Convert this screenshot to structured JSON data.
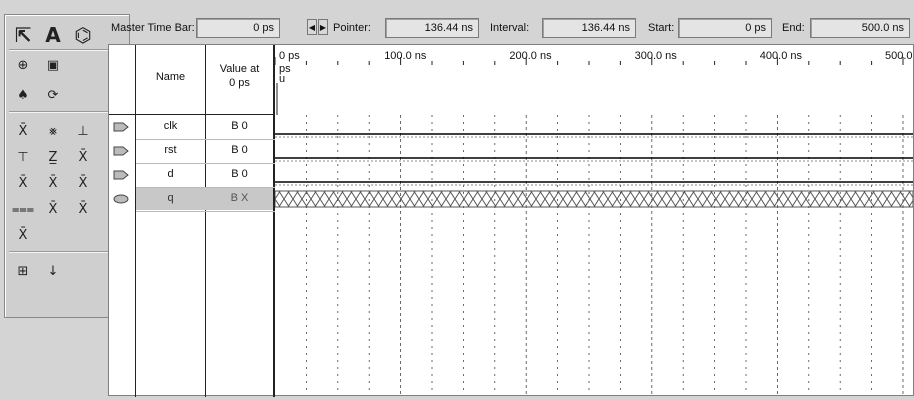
{
  "palette": {
    "tools": [
      {
        "name": "pointer-tool-icon",
        "glyph": "⇱"
      },
      {
        "name": "text-tool-icon",
        "glyph": "A"
      },
      {
        "name": "waveform-editing-tool-icon",
        "glyph": "⌬"
      },
      {
        "name": "zoom-tool-icon",
        "glyph": "⊕"
      },
      {
        "name": "full-screen-icon",
        "glyph": "▣"
      },
      {
        "name": "find-icon",
        "glyph": "♠"
      },
      {
        "name": "replace-icon",
        "glyph": "⟳"
      },
      {
        "name": "forcing-unknown-icon",
        "glyph": "X̄"
      },
      {
        "name": "forcing-dont-care-icon",
        "glyph": "⨳"
      },
      {
        "name": "forcing-low-icon",
        "glyph": "⊥"
      },
      {
        "name": "forcing-high-icon",
        "glyph": "⊤"
      },
      {
        "name": "forcing-high-impedance-icon",
        "glyph": "Z̲"
      },
      {
        "name": "forcing-weak-icon",
        "glyph": "X̄"
      },
      {
        "name": "forcing-weak-low-icon",
        "glyph": "X̄"
      },
      {
        "name": "forcing-weak-high-icon",
        "glyph": "X̄"
      },
      {
        "name": "invert-icon",
        "glyph": "X̄"
      },
      {
        "name": "count-value-icon",
        "glyph": "⩶"
      },
      {
        "name": "clock-value-icon",
        "glyph": "X̄"
      },
      {
        "name": "arbitrary-value-icon",
        "glyph": "X̄"
      },
      {
        "name": "random-value-icon",
        "glyph": "X̄"
      },
      {
        "name": "snap-to-grid-icon",
        "glyph": "⊞"
      },
      {
        "name": "sort-icon",
        "glyph": "↓"
      }
    ]
  },
  "timebar": {
    "master_label": "Master Time Bar:",
    "master_value": "0 ps",
    "pointer_label": "Pointer:",
    "pointer_value": "136.44 ns",
    "interval_label": "Interval:",
    "interval_value": "136.44 ns",
    "start_label": "Start:",
    "start_value": "0 ps",
    "end_label": "End:",
    "end_value": "500.0 ns"
  },
  "table": {
    "header_name": "Name",
    "header_value_line1": "Value at",
    "header_value_line2": "0 ps",
    "rows": [
      {
        "name": "clk",
        "value": "B 0",
        "type": "input"
      },
      {
        "name": "rst",
        "value": "B 0",
        "type": "input"
      },
      {
        "name": "d",
        "value": "B 0",
        "type": "input"
      },
      {
        "name": "q",
        "value": "B X",
        "type": "output",
        "selected": true
      }
    ]
  },
  "timeline": {
    "ticks": [
      "0 ps",
      "100.0 ns",
      "200.0 ns",
      "300.0 ns",
      "400.0 ns",
      "500.0 ns"
    ],
    "cursor_label_line1": "ps",
    "cursor_label_line2": "u"
  },
  "colors": {
    "selected_row": "#c8c8c8",
    "waveform": "#000000",
    "undefined_hatch": "#555555"
  }
}
